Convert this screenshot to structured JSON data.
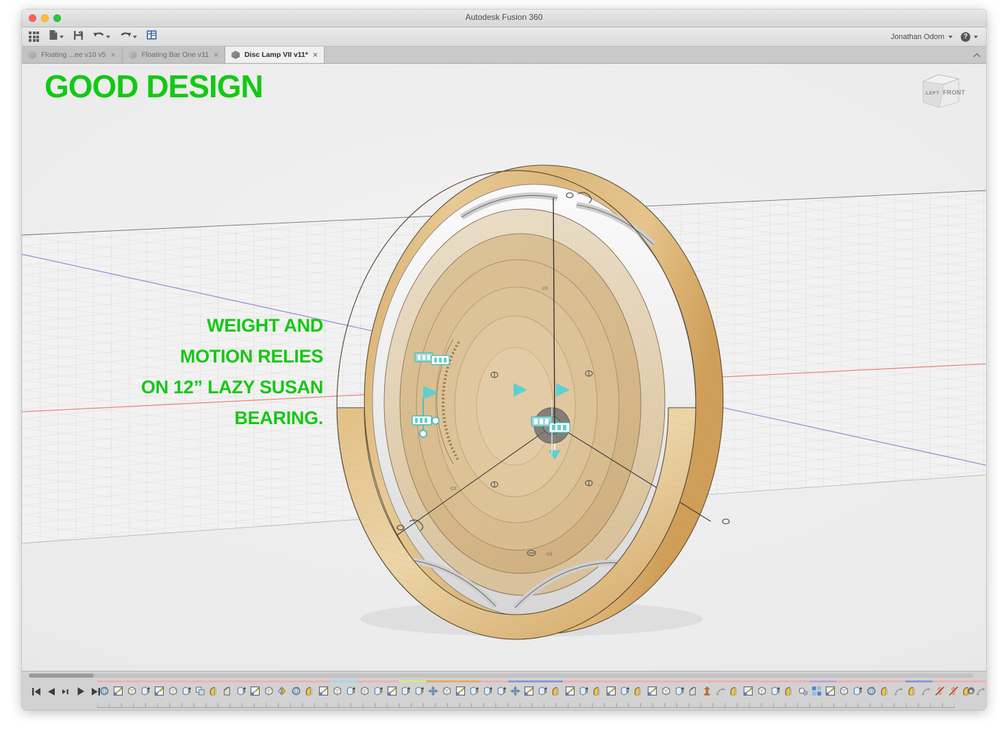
{
  "window": {
    "title": "Autodesk Fusion 360",
    "traffic_lights": [
      "close",
      "minimize",
      "maximize"
    ]
  },
  "toolbar": {
    "items": [
      {
        "name": "app-grid",
        "icon": "grid-icon",
        "has_caret": false
      },
      {
        "name": "new-file",
        "icon": "file-icon",
        "has_caret": true
      },
      {
        "name": "save",
        "icon": "save-icon",
        "has_caret": false
      },
      {
        "name": "undo",
        "icon": "undo-arrow-icon",
        "has_caret": true
      },
      {
        "name": "redo",
        "icon": "redo-arrow-icon",
        "has_caret": true
      },
      {
        "name": "panel-toggle",
        "icon": "panel-icon",
        "has_caret": false
      }
    ],
    "user_name": "Jonathan Odom",
    "help_label": "?"
  },
  "tabs": [
    {
      "label": "Floating ...ee v10 v5",
      "active": false,
      "close": "×"
    },
    {
      "label": "Floating Bar One v11",
      "active": false,
      "close": "×"
    },
    {
      "label": "Disc Lamp VII v11*",
      "active": true,
      "close": "×"
    }
  ],
  "tab_chevron": "⌃",
  "overlay": {
    "title": "GOOD DESIGN",
    "title_color": "#14c814",
    "body_color": "#14c814",
    "body_lines": [
      "WEIGHT AND",
      "MOTION RELIES",
      "ON 12” LAZY SUSAN",
      "BEARING."
    ]
  },
  "viewcube": {
    "left_face": "LEFT",
    "front_face": "FRONT"
  },
  "viewport": {
    "axis_red": "#e8736a",
    "axis_blue": "#8b7fd4",
    "grid_color": "#9a9a9a",
    "wood_light": "#e6c893",
    "wood_mid": "#dcb878",
    "wood_dark": "#c79a52",
    "model_name": "disc-lamp-assembly"
  },
  "timeline": {
    "playback": [
      {
        "name": "skip-to-start-button",
        "glyph": "⏮"
      },
      {
        "name": "step-back-button",
        "glyph": "◀"
      },
      {
        "name": "step-forward-button",
        "glyph": "▶"
      },
      {
        "name": "play-button",
        "glyph": "▶"
      },
      {
        "name": "skip-to-end-button",
        "glyph": "⏭"
      }
    ],
    "settings_label": "⚙",
    "groups": [
      {
        "color": "#f4b0b0",
        "features": [
          "revolve",
          "sketch",
          "body",
          "extrude",
          "sketch",
          "body",
          "extrude",
          "combine",
          "fillet",
          "chamfer"
        ]
      },
      {
        "color": "#f4b0b0",
        "features": [
          "extrude",
          "sketch",
          "body",
          "mirror",
          "revolve",
          "fillet",
          "sketch"
        ]
      },
      {
        "color": "#a8d4ec",
        "features": [
          "body",
          "extrude"
        ]
      },
      {
        "color": "#f4b0b0",
        "features": [
          "body",
          "extrude",
          "sketch"
        ]
      },
      {
        "color": "#d8e878",
        "features": [
          "extrude",
          "extrude"
        ]
      },
      {
        "color": "#f0a860",
        "features": [
          "move",
          "body",
          "sketch",
          "extrude"
        ]
      },
      {
        "color": "#f4b0b0",
        "features": [
          "extrude",
          "extrude"
        ]
      },
      {
        "color": "#8899dd",
        "features": [
          "move",
          "sketch",
          "extrude",
          "fillet"
        ]
      },
      {
        "color": "#f4b0b0",
        "features": [
          "sketch",
          "extrude",
          "fillet",
          "sketch",
          "extrude",
          "fillet",
          "sketch",
          "body",
          "extrude"
        ]
      },
      {
        "color": "#f4b0b0",
        "features": [
          "chamfer",
          "joint",
          "joint-origin",
          "fillet",
          "sketch"
        ]
      },
      {
        "color": "#f4b0b0",
        "features": [
          "body",
          "extrude",
          "fillet",
          "component"
        ]
      },
      {
        "color": "#c4a0e0",
        "features": [
          "pattern",
          "sketch"
        ]
      },
      {
        "color": "#f4b0b0",
        "features": [
          "body",
          "extrude",
          "revolve",
          "fillet",
          "joint-origin"
        ]
      },
      {
        "color": "#8899dd",
        "features": [
          "fillet",
          "joint-origin"
        ]
      },
      {
        "color": "#f4b0b0",
        "features": [
          "suppressed",
          "suppressed",
          "fillet",
          "joint-origin",
          "pattern",
          "sketch",
          "body",
          "extrude"
        ]
      },
      {
        "color": "#f4b0b0",
        "features": [
          "extrude"
        ]
      },
      {
        "color": "#d8e878",
        "features": [
          "extrude"
        ]
      }
    ]
  }
}
